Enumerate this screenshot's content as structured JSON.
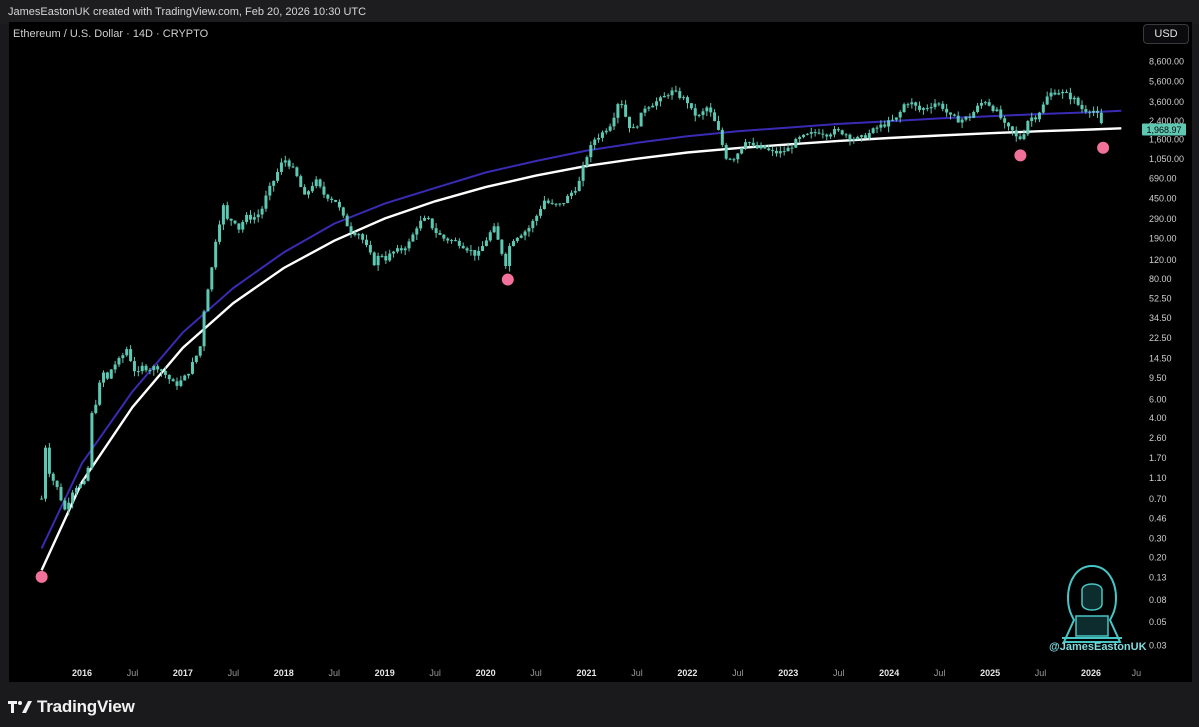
{
  "header": {
    "attribution": "JamesEastonUK created with TradingView.com, Feb 20, 2026 10:30 UTC",
    "symbol_title": "Ethereum / U.S. Dollar · 14D · CRYPTO",
    "currency_button": "USD"
  },
  "footer": {
    "brand": "TradingView"
  },
  "watermark": {
    "handle": "@JamesEastonUK",
    "icon": "hooded-hacker-icon"
  },
  "colors": {
    "background": "#000000",
    "candle": "#5ec8b2",
    "upper_curve": "#3a2bb5",
    "lower_curve": "#ffffff",
    "markers": "#f2719a",
    "last_price_tag": "#5ec8b2"
  },
  "chart_data": {
    "type": "line",
    "scale": "log",
    "y_ticks": [
      "8,600.00",
      "5,600.00",
      "3,600.00",
      "2,400.00",
      "1,600.00",
      "1,050.00",
      "690.00",
      "450.00",
      "290.00",
      "190.00",
      "120.00",
      "80.00",
      "52.50",
      "34.50",
      "22.50",
      "14.50",
      "9.50",
      "6.00",
      "4.00",
      "2.60",
      "1.70",
      "1.10",
      "0.70",
      "0.46",
      "0.30",
      "0.20",
      "0.13",
      "0.08",
      "0.05",
      "0.03"
    ],
    "y_tick_values": [
      8600,
      5600,
      3600,
      2400,
      1600,
      1050,
      690,
      450,
      290,
      190,
      120,
      80,
      52.5,
      34.5,
      22.5,
      14.5,
      9.5,
      6,
      4,
      2.6,
      1.7,
      1.1,
      0.7,
      0.46,
      0.3,
      0.2,
      0.13,
      0.08,
      0.05,
      0.03
    ],
    "x_ticks": [
      {
        "label": "2016",
        "t": 2016.0,
        "bold": true
      },
      {
        "label": "Jul",
        "t": 2016.5,
        "bold": false
      },
      {
        "label": "2017",
        "t": 2017.0,
        "bold": true
      },
      {
        "label": "Jul",
        "t": 2017.5,
        "bold": false
      },
      {
        "label": "2018",
        "t": 2018.0,
        "bold": true
      },
      {
        "label": "Jul",
        "t": 2018.5,
        "bold": false
      },
      {
        "label": "2019",
        "t": 2019.0,
        "bold": true
      },
      {
        "label": "Jul",
        "t": 2019.5,
        "bold": false
      },
      {
        "label": "2020",
        "t": 2020.0,
        "bold": true
      },
      {
        "label": "Jul",
        "t": 2020.5,
        "bold": false
      },
      {
        "label": "2021",
        "t": 2021.0,
        "bold": true
      },
      {
        "label": "Jul",
        "t": 2021.5,
        "bold": false
      },
      {
        "label": "2022",
        "t": 2022.0,
        "bold": true
      },
      {
        "label": "Jul",
        "t": 2022.5,
        "bold": false
      },
      {
        "label": "2023",
        "t": 2023.0,
        "bold": true
      },
      {
        "label": "Jul",
        "t": 2023.5,
        "bold": false
      },
      {
        "label": "2024",
        "t": 2024.0,
        "bold": true
      },
      {
        "label": "Jul",
        "t": 2024.5,
        "bold": false
      },
      {
        "label": "2025",
        "t": 2025.0,
        "bold": true
      },
      {
        "label": "Jul",
        "t": 2025.5,
        "bold": false
      },
      {
        "label": "2026",
        "t": 2026.0,
        "bold": true
      },
      {
        "label": "Ju",
        "t": 2026.45,
        "bold": false
      }
    ],
    "last_price": "1,968.97",
    "last_price_value": 1968.97,
    "price_path": [
      [
        2015.6,
        0.7
      ],
      [
        2015.62,
        2.8
      ],
      [
        2015.68,
        1.2
      ],
      [
        2015.75,
        0.9
      ],
      [
        2015.83,
        0.55
      ],
      [
        2015.92,
        0.9
      ],
      [
        2016.0,
        0.95
      ],
      [
        2016.05,
        1.0
      ],
      [
        2016.1,
        4.5
      ],
      [
        2016.15,
        6
      ],
      [
        2016.2,
        11
      ],
      [
        2016.25,
        9
      ],
      [
        2016.3,
        12
      ],
      [
        2016.38,
        14
      ],
      [
        2016.45,
        18
      ],
      [
        2016.5,
        12
      ],
      [
        2016.55,
        10
      ],
      [
        2016.6,
        12
      ],
      [
        2016.67,
        11.5
      ],
      [
        2016.75,
        12
      ],
      [
        2016.83,
        10
      ],
      [
        2016.92,
        8
      ],
      [
        2017.0,
        9
      ],
      [
        2017.05,
        10.5
      ],
      [
        2017.1,
        13
      ],
      [
        2017.17,
        18
      ],
      [
        2017.22,
        50
      ],
      [
        2017.28,
        90
      ],
      [
        2017.33,
        200
      ],
      [
        2017.4,
        380
      ],
      [
        2017.45,
        260
      ],
      [
        2017.5,
        300
      ],
      [
        2017.55,
        230
      ],
      [
        2017.62,
        300
      ],
      [
        2017.7,
        295
      ],
      [
        2017.77,
        330
      ],
      [
        2017.83,
        480
      ],
      [
        2017.92,
        720
      ],
      [
        2018.0,
        1050
      ],
      [
        2018.05,
        950
      ],
      [
        2018.1,
        800
      ],
      [
        2018.15,
        650
      ],
      [
        2018.2,
        450
      ],
      [
        2018.28,
        600
      ],
      [
        2018.33,
        650
      ],
      [
        2018.38,
        500
      ],
      [
        2018.45,
        460
      ],
      [
        2018.52,
        420
      ],
      [
        2018.6,
        280
      ],
      [
        2018.67,
        220
      ],
      [
        2018.75,
        210
      ],
      [
        2018.83,
        150
      ],
      [
        2018.9,
        110
      ],
      [
        2018.96,
        140
      ],
      [
        2019.0,
        120
      ],
      [
        2019.08,
        140
      ],
      [
        2019.17,
        150
      ],
      [
        2019.25,
        175
      ],
      [
        2019.33,
        260
      ],
      [
        2019.42,
        290
      ],
      [
        2019.5,
        220
      ],
      [
        2019.58,
        190
      ],
      [
        2019.67,
        180
      ],
      [
        2019.75,
        170
      ],
      [
        2019.83,
        150
      ],
      [
        2019.92,
        130
      ],
      [
        2020.0,
        180
      ],
      [
        2020.08,
        240
      ],
      [
        2020.15,
        150
      ],
      [
        2020.2,
        110
      ],
      [
        2020.25,
        180
      ],
      [
        2020.33,
        205
      ],
      [
        2020.42,
        230
      ],
      [
        2020.5,
        300
      ],
      [
        2020.58,
        430
      ],
      [
        2020.67,
        380
      ],
      [
        2020.75,
        390
      ],
      [
        2020.83,
        480
      ],
      [
        2020.92,
        600
      ],
      [
        2021.0,
        1100
      ],
      [
        2021.08,
        1600
      ],
      [
        2021.15,
        1800
      ],
      [
        2021.25,
        2300
      ],
      [
        2021.33,
        4000
      ],
      [
        2021.4,
        2400
      ],
      [
        2021.45,
        1900
      ],
      [
        2021.5,
        2200
      ],
      [
        2021.58,
        3200
      ],
      [
        2021.67,
        3500
      ],
      [
        2021.75,
        3800
      ],
      [
        2021.83,
        4500
      ],
      [
        2021.9,
        4200
      ],
      [
        2022.0,
        3600
      ],
      [
        2022.05,
        2800
      ],
      [
        2022.12,
        2600
      ],
      [
        2022.2,
        3200
      ],
      [
        2022.3,
        2000
      ],
      [
        2022.38,
        1100
      ],
      [
        2022.45,
        1050
      ],
      [
        2022.5,
        1200
      ],
      [
        2022.58,
        1600
      ],
      [
        2022.67,
        1300
      ],
      [
        2022.75,
        1350
      ],
      [
        2022.83,
        1200
      ],
      [
        2022.92,
        1200
      ],
      [
        2023.0,
        1300
      ],
      [
        2023.1,
        1600
      ],
      [
        2023.2,
        1750
      ],
      [
        2023.3,
        1900
      ],
      [
        2023.38,
        1800
      ],
      [
        2023.45,
        1900
      ],
      [
        2023.55,
        1850
      ],
      [
        2023.62,
        1650
      ],
      [
        2023.7,
        1600
      ],
      [
        2023.8,
        1800
      ],
      [
        2023.88,
        2050
      ],
      [
        2024.0,
        2300
      ],
      [
        2024.08,
        2500
      ],
      [
        2024.15,
        3400
      ],
      [
        2024.2,
        3600
      ],
      [
        2024.3,
        3000
      ],
      [
        2024.38,
        3200
      ],
      [
        2024.45,
        3500
      ],
      [
        2024.52,
        3300
      ],
      [
        2024.6,
        2600
      ],
      [
        2024.7,
        2400
      ],
      [
        2024.8,
        2600
      ],
      [
        2024.9,
        3400
      ],
      [
        2024.96,
        3700
      ],
      [
        2025.0,
        3300
      ],
      [
        2025.08,
        2800
      ],
      [
        2025.15,
        2100
      ],
      [
        2025.22,
        1900
      ],
      [
        2025.28,
        1550
      ],
      [
        2025.33,
        1800
      ],
      [
        2025.38,
        2500
      ],
      [
        2025.45,
        2600
      ],
      [
        2025.52,
        3200
      ],
      [
        2025.58,
        4200
      ],
      [
        2025.66,
        4500
      ],
      [
        2025.75,
        4200
      ],
      [
        2025.83,
        3800
      ],
      [
        2025.9,
        3100
      ],
      [
        2025.96,
        3000
      ],
      [
        2026.0,
        3000
      ],
      [
        2026.05,
        2900
      ],
      [
        2026.1,
        2200
      ],
      [
        2026.13,
        1968.97
      ]
    ],
    "upper_curve": [
      [
        2015.6,
        0.24
      ],
      [
        2016.0,
        1.5
      ],
      [
        2016.5,
        7
      ],
      [
        2017.0,
        25
      ],
      [
        2017.5,
        65
      ],
      [
        2018.0,
        140
      ],
      [
        2018.5,
        260
      ],
      [
        2019.0,
        400
      ],
      [
        2019.5,
        560
      ],
      [
        2020.0,
        780
      ],
      [
        2020.5,
        1000
      ],
      [
        2021.0,
        1250
      ],
      [
        2021.5,
        1480
      ],
      [
        2022.0,
        1700
      ],
      [
        2022.5,
        1900
      ],
      [
        2023.0,
        2050
      ],
      [
        2023.5,
        2220
      ],
      [
        2024.0,
        2350
      ],
      [
        2024.5,
        2500
      ],
      [
        2025.0,
        2620
      ],
      [
        2025.5,
        2750
      ],
      [
        2026.0,
        2860
      ],
      [
        2026.3,
        2950
      ]
    ],
    "lower_curve": [
      [
        2015.6,
        0.15
      ],
      [
        2016.0,
        1.0
      ],
      [
        2016.5,
        5
      ],
      [
        2017.0,
        18
      ],
      [
        2017.5,
        47
      ],
      [
        2018.0,
        100
      ],
      [
        2018.5,
        180
      ],
      [
        2019.0,
        290
      ],
      [
        2019.5,
        420
      ],
      [
        2020.0,
        570
      ],
      [
        2020.5,
        730
      ],
      [
        2021.0,
        900
      ],
      [
        2021.5,
        1050
      ],
      [
        2022.0,
        1200
      ],
      [
        2022.5,
        1320
      ],
      [
        2023.0,
        1430
      ],
      [
        2023.5,
        1540
      ],
      [
        2024.0,
        1640
      ],
      [
        2024.5,
        1730
      ],
      [
        2025.0,
        1820
      ],
      [
        2025.5,
        1900
      ],
      [
        2026.0,
        1970
      ],
      [
        2026.3,
        2020
      ]
    ],
    "markers": [
      [
        2015.6,
        0.13
      ],
      [
        2020.22,
        78
      ],
      [
        2025.3,
        1130
      ],
      [
        2026.12,
        1330
      ]
    ]
  }
}
